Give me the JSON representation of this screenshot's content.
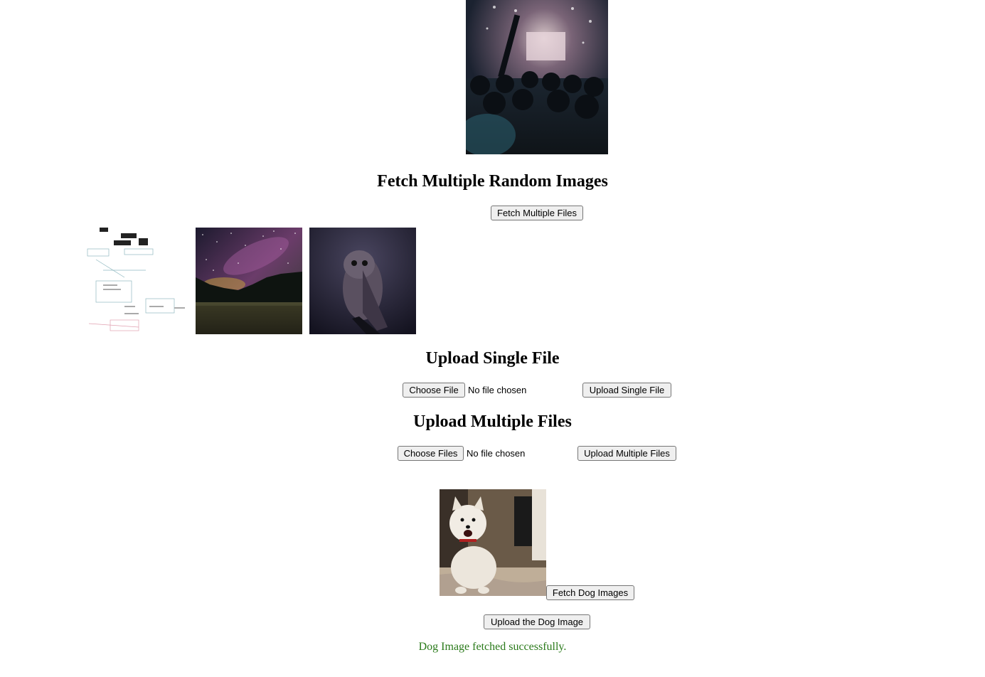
{
  "sections": {
    "fetch_multiple_heading": "Fetch Multiple Random Images",
    "fetch_multiple_button": "Fetch Multiple Files",
    "upload_single_heading": "Upload Single File",
    "upload_single": {
      "choose_label": "Choose File",
      "status": "No file chosen",
      "upload_button": "Upload Single File"
    },
    "upload_multiple_heading": "Upload Multiple Files",
    "upload_multiple": {
      "choose_label": "Choose Files",
      "status": "No file chosen",
      "upload_button": "Upload Multiple Files"
    },
    "dog": {
      "fetch_button": "Fetch Dog Images",
      "upload_button": "Upload the Dog Image",
      "status_message": "Dog Image fetched successfully.",
      "status_color": "#2a7a1a"
    }
  }
}
